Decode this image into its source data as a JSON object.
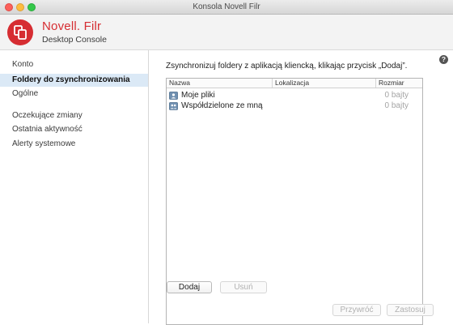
{
  "window": {
    "title": "Konsola Novell Filr"
  },
  "header": {
    "brand_name": "Novell. Filr",
    "brand_sub": "Desktop Console"
  },
  "sidebar": {
    "items": [
      {
        "label": "Konto",
        "active": false
      },
      {
        "label": "Foldery do zsynchronizowania",
        "active": true
      },
      {
        "label": "Ogólne",
        "active": false
      },
      {
        "label": "Oczekujące zmiany",
        "active": false
      },
      {
        "label": "Ostatnia aktywność",
        "active": false
      },
      {
        "label": "Alerty systemowe",
        "active": false
      }
    ]
  },
  "main": {
    "instruction": "Zsynchronizuj foldery z aplikacją kliencką, klikając przycisk „Dodaj”.",
    "help_icon": "question-icon",
    "table": {
      "columns": [
        "Nazwa",
        "Lokalizacja",
        "Rozmiar"
      ],
      "rows": [
        {
          "name": "Moje pliki",
          "location": "",
          "size": "0 bajty",
          "icon": "folder-user-icon"
        },
        {
          "name": "Współdzielone ze mną",
          "location": "",
          "size": "0 bajty",
          "icon": "folder-shared-icon"
        }
      ]
    },
    "buttons": {
      "add": "Dodaj",
      "remove": "Usuń",
      "revert": "Przywróć",
      "apply": "Zastosuj"
    }
  },
  "colors": {
    "brand": "#d62d32",
    "selection": "#dbe9f6"
  }
}
